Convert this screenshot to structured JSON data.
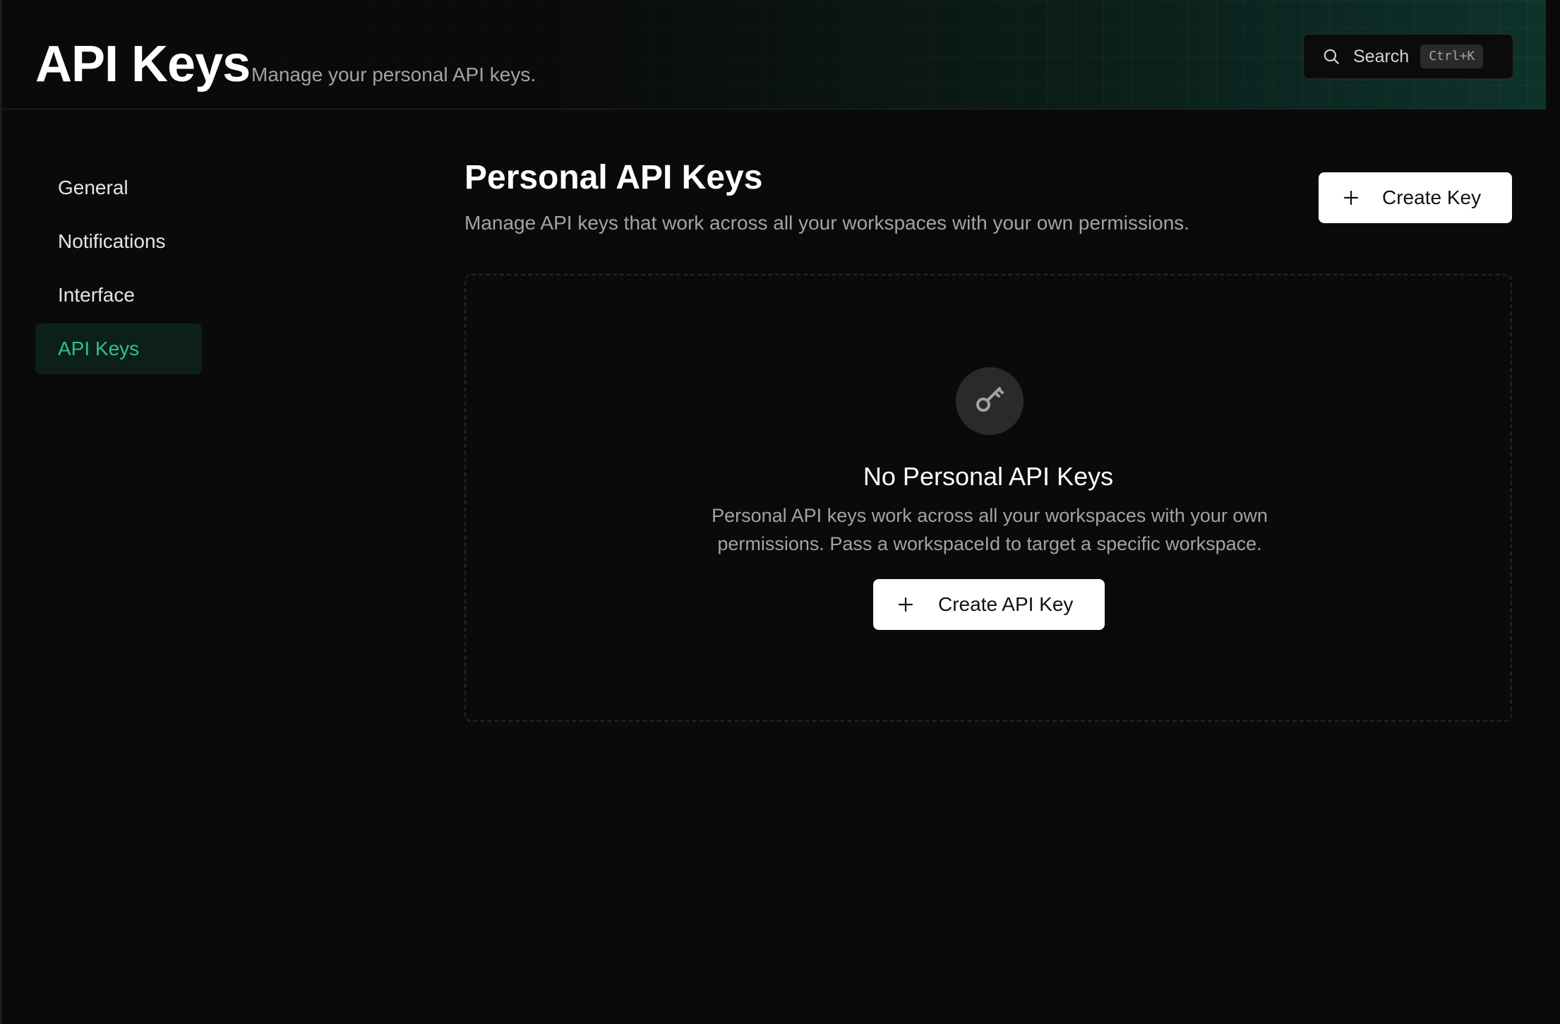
{
  "header": {
    "title": "API Keys",
    "subtitle": "Manage your personal API keys.",
    "search": {
      "label": "Search",
      "shortcut": "Ctrl+K",
      "icon": "search-icon"
    }
  },
  "sidebar": {
    "items": [
      {
        "label": "General",
        "active": false
      },
      {
        "label": "Notifications",
        "active": false
      },
      {
        "label": "Interface",
        "active": false
      },
      {
        "label": "API Keys",
        "active": true
      }
    ]
  },
  "main": {
    "title": "Personal API Keys",
    "description": "Manage API keys that work across all your workspaces with your own permissions.",
    "create_button": {
      "label": "Create Key",
      "icon": "plus-icon"
    },
    "empty_state": {
      "icon": "key-icon",
      "title": "No Personal API Keys",
      "description": "Personal API keys work across all your workspaces with your own permissions. Pass a workspaceId to target a specific workspace.",
      "button": {
        "label": "Create API Key",
        "icon": "plus-icon"
      }
    }
  },
  "colors": {
    "background": "#0a0a0a",
    "accent": "#2fbf92",
    "active_bg": "#0d1f1b",
    "muted_text": "#a3a3a3",
    "button_bg": "#ffffff"
  }
}
